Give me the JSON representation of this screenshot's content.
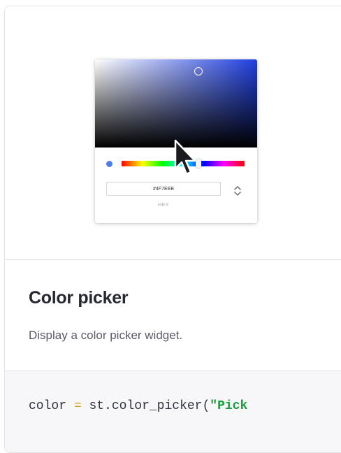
{
  "picker": {
    "hex_value": "#4F7EEB",
    "hex_label": "HEX",
    "swatch_color": "#4f7eeb",
    "hue_color": "#1f3fe0"
  },
  "card": {
    "title": "Color picker",
    "description": "Display a color picker widget."
  },
  "code": {
    "var": "color",
    "op": "=",
    "call": "st.color_picker(",
    "string": "\"Pick"
  },
  "icons": {
    "cursor": "mouse-pointer-icon",
    "toggle": "up-down-chevron-icon"
  }
}
